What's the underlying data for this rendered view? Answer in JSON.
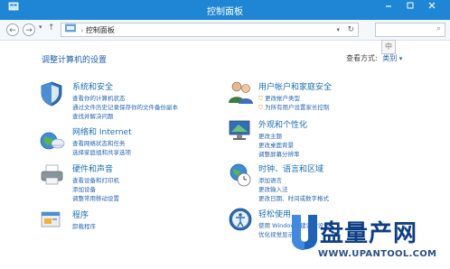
{
  "window": {
    "title": "控制面板"
  },
  "nav": {
    "address": "控制面板",
    "ime_label": "中"
  },
  "main": {
    "heading": "调整计算机的设置",
    "view_by_label": "查看方式:",
    "view_by_value": "类别"
  },
  "categories": [
    {
      "title": "系统和安全",
      "links": [
        "查看你的计算机状态",
        "通过文件历史记录保存你的文件备份副本",
        "查找并解决问题"
      ],
      "icon": "shield-icon"
    },
    {
      "title": "网络和 Internet",
      "links": [
        "查看网络状态和任务",
        "选择家庭组和共享选项"
      ],
      "icon": "network-globe-icon"
    },
    {
      "title": "硬件和声音",
      "links": [
        "查看设备和打印机",
        "添加设备",
        "调整常用移动设置"
      ],
      "icon": "printer-icon"
    },
    {
      "title": "程序",
      "links": [
        "卸载程序"
      ],
      "icon": "programs-icon"
    },
    {
      "title": "用户帐户和家庭安全",
      "links": [
        "更改帐户类型",
        "为所有用户设置家长控制"
      ],
      "icon": "users-icon"
    },
    {
      "title": "外观和个性化",
      "links": [
        "更改主题",
        "更改桌面背景",
        "调整屏幕分辨率"
      ],
      "icon": "monitor-icon"
    },
    {
      "title": "时钟、语言和区域",
      "links": [
        "添加语言",
        "更改输入法",
        "更改日期、时间或数字格式"
      ],
      "icon": "clock-globe-icon"
    },
    {
      "title": "轻松使用",
      "links": [
        "使用 Windows 建议的设置",
        "优化视觉显示"
      ],
      "icon": "ease-of-access-icon"
    }
  ],
  "watermark": {
    "brand": "盘量产网",
    "url": "WWW.UPANTOOL.COM"
  },
  "colors": {
    "titlebar": "#1e86d4",
    "link": "#2867b2",
    "heading": "#1e5fa7"
  }
}
